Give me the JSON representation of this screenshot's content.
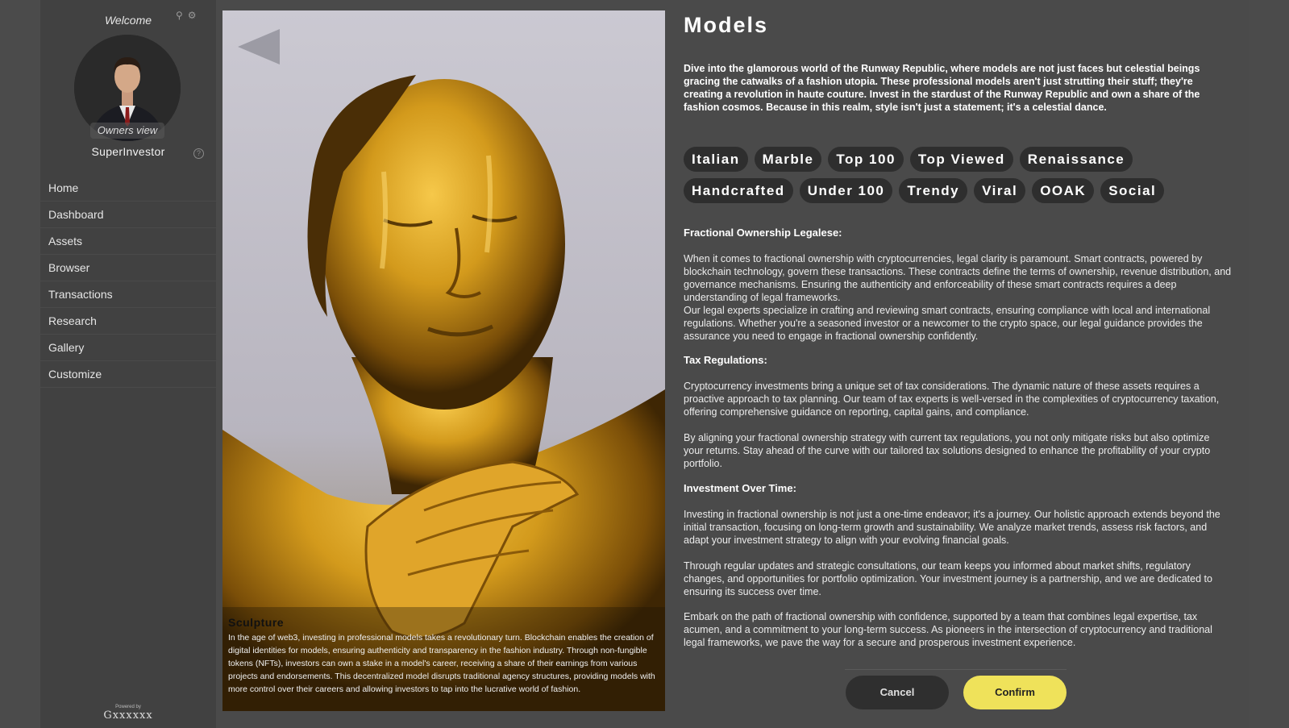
{
  "sidebar": {
    "welcome": "Welcome",
    "owners_view": "Owners view",
    "username": "SuperInvestor",
    "help": "?",
    "items": [
      {
        "label": "Home"
      },
      {
        "label": "Dashboard"
      },
      {
        "label": "Assets"
      },
      {
        "label": "Browser"
      },
      {
        "label": "Transactions"
      },
      {
        "label": "Research"
      },
      {
        "label": "Gallery"
      },
      {
        "label": "Customize"
      }
    ],
    "powered_by": "Powered by",
    "logo_text": "Gxxxxxx"
  },
  "image_panel": {
    "caption_title": "Sculpture",
    "caption_text": "In the age of web3, investing in professional models takes a revolutionary turn. Blockchain enables the creation of digital identities for models, ensuring authenticity and transparency in the fashion industry. Through non-fungible tokens (NFTs), investors can own a stake in a model's career, receiving a share of their earnings from various projects and endorsements. This decentralized model disrupts traditional agency structures, providing models with more control over their careers and allowing investors to tap into the lucrative world of fashion."
  },
  "content": {
    "title": "Models",
    "intro": "Dive into the glamorous world of the Runway Republic, where models are not just faces but celestial beings gracing the catwalks of a fashion utopia. These professional models aren't just strutting their stuff; they're creating a revolution in haute couture. Invest in the stardust of the Runway Republic and own a share of the fashion cosmos. Because in this realm, style isn't just a statement; it's a celestial dance.",
    "tags_row1": [
      "Italian",
      "Marble",
      "Top 100",
      "Top Viewed",
      "Renaissance"
    ],
    "tags_row2": [
      "Handcrafted",
      "Under 100",
      "Trendy",
      "Viral",
      "OOAK",
      "Social"
    ],
    "legal_head": "Fractional Ownership Legalese:",
    "legal_p1": "When it comes to fractional ownership with cryptocurrencies, legal clarity is paramount. Smart contracts, powered by blockchain technology, govern these transactions. These contracts define the terms of ownership, revenue distribution, and governance mechanisms. Ensuring the authenticity and enforceability of these smart contracts requires a deep understanding of legal frameworks.",
    "legal_p2": "Our legal experts specialize in crafting and reviewing smart contracts, ensuring compliance with local and international regulations. Whether you're a seasoned investor or a newcomer to the crypto space, our legal guidance provides the assurance you need to engage in fractional ownership confidently.",
    "tax_head": "Tax Regulations:",
    "tax_p1": "Cryptocurrency investments bring a unique set of tax considerations. The dynamic nature of these assets requires a proactive approach to tax planning. Our team of tax experts is well-versed in the complexities of cryptocurrency taxation, offering comprehensive guidance on reporting, capital gains, and compliance.",
    "tax_p2": "By aligning your fractional ownership strategy with current tax regulations, you not only mitigate risks but also optimize your returns. Stay ahead of the curve with our tailored tax solutions designed to enhance the profitability of your crypto portfolio.",
    "invest_head": "Investment Over Time:",
    "invest_p1": "Investing in fractional ownership is not just a one-time endeavor; it's a journey. Our holistic approach extends beyond the initial transaction, focusing on long-term growth and sustainability. We analyze market trends, assess risk factors, and adapt your investment strategy to align with your evolving financial goals.",
    "invest_p2": "Through regular updates and strategic consultations, our team keeps you informed about market shifts, regulatory changes, and opportunities for portfolio optimization. Your investment journey is a partnership, and we are dedicated to ensuring its success over time.",
    "invest_p3": "Embark on the path of fractional ownership with confidence, supported by a team that combines legal expertise, tax acumen, and a commitment to your long-term success. As pioneers in the intersection of cryptocurrency and traditional legal frameworks, we pave the way for a secure and prosperous investment experience.",
    "cancel_label": "Cancel",
    "confirm_label": "Confirm"
  },
  "colors": {
    "background": "#4a4a4a",
    "sidebar": "#414141",
    "tag_bg": "#2e2e2e",
    "confirm_bg": "#efe25a",
    "cancel_bg": "#2f2f2f"
  }
}
